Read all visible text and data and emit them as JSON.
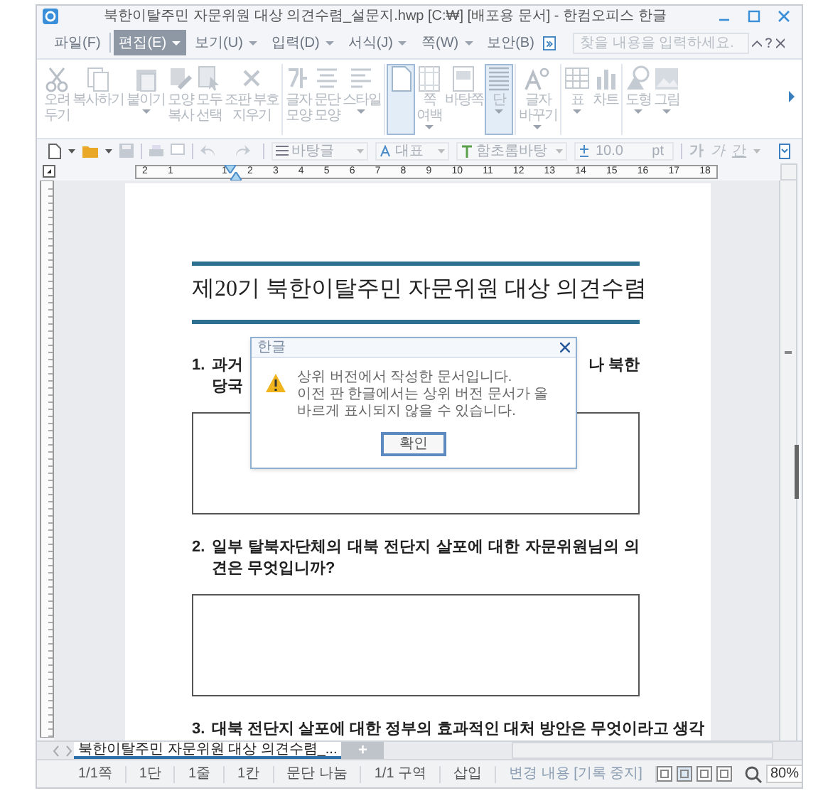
{
  "window": {
    "title": "북한이탈주민 자문위원 대상 의견수렴_설문지.hwp [C:₩] [배포용 문서] - 한컴오피스 한글"
  },
  "menu": [
    {
      "label": "파일(F)",
      "selected": false,
      "dropdown": false
    },
    {
      "label": "편집(E)",
      "selected": true,
      "dropdown": true
    },
    {
      "label": "보기(U)",
      "selected": false,
      "dropdown": true
    },
    {
      "label": "입력(D)",
      "selected": false,
      "dropdown": true
    },
    {
      "label": "서식(J)",
      "selected": false,
      "dropdown": true
    },
    {
      "label": "쪽(W)",
      "selected": false,
      "dropdown": true
    },
    {
      "label": "보안(B)",
      "selected": false,
      "dropdown": false
    }
  ],
  "search": {
    "placeholder": "찾을 내용을 입력하세요."
  },
  "ribbon": [
    [
      {
        "lines": [
          "오려",
          "두기"
        ],
        "dropdown": false,
        "selected": false
      },
      {
        "lines": [
          "복사하기"
        ],
        "dropdown": false,
        "selected": false
      },
      {
        "lines": [
          "붙이기"
        ],
        "dropdown": true,
        "selected": false
      },
      {
        "lines": [
          "모양",
          "복사"
        ],
        "dropdown": false,
        "selected": false
      },
      {
        "lines": [
          "모두",
          "선택"
        ],
        "dropdown": false,
        "selected": false
      },
      {
        "lines": [
          "조판 부호",
          "지우기"
        ],
        "dropdown": false,
        "selected": false
      }
    ],
    [
      {
        "lines": [
          "글자",
          "모양"
        ],
        "dropdown": false,
        "selected": false
      },
      {
        "lines": [
          "문단",
          "모양"
        ],
        "dropdown": false,
        "selected": false
      },
      {
        "lines": [
          "스타일"
        ],
        "dropdown": true,
        "selected": false
      }
    ],
    [
      {
        "dropdown": false,
        "selected": true
      },
      {
        "lines": [
          "쪽",
          "여백"
        ],
        "dropdown": true,
        "selected": false
      },
      {
        "lines": [
          "바탕쪽"
        ],
        "dropdown": false,
        "selected": false
      },
      {
        "lines": [
          "단"
        ],
        "dropdown": true,
        "selected": true
      }
    ],
    [
      {
        "lines": [
          "글자",
          "바꾸기"
        ],
        "dropdown": true,
        "selected": false
      }
    ],
    [
      {
        "lines": [
          "표"
        ],
        "dropdown": true,
        "selected": false
      },
      {
        "lines": [
          "차트"
        ],
        "dropdown": false,
        "selected": false
      }
    ],
    [
      {
        "lines": [
          "도형"
        ],
        "dropdown": true,
        "selected": false
      },
      {
        "lines": [
          "그림"
        ],
        "dropdown": true,
        "selected": false
      }
    ]
  ],
  "toolbar": {
    "style": "바탕글",
    "language": "대표",
    "font": "함초롬바탕",
    "size": "10.0",
    "unit": "pt",
    "format": [
      "가",
      "가",
      "간"
    ]
  },
  "ruler": {
    "labels": [
      "2",
      "1",
      "1",
      "2",
      "3",
      "4",
      "5",
      "6",
      "7",
      "8",
      "9",
      "10",
      "11",
      "12",
      "13",
      "14",
      "15",
      "16",
      "17",
      "18"
    ]
  },
  "document": {
    "title": "제20기 북한이탈주민 자문위원 대상 의견수렴",
    "questions": [
      {
        "number": "1.",
        "kind": "partial",
        "parts": [
          "과거",
          "나 북한",
          "당국"
        ],
        "answer_box": true
      },
      {
        "number": "2.",
        "kind": "full",
        "text": "일부 탈북자단체의 대북 전단지 살포에 대한 자문위원님의 의견은 무엇입니까?",
        "answer_box": true
      },
      {
        "number": "3.",
        "kind": "full",
        "text": "대북 전단지 살포에 대한 정부의 효과적인 대처 방안은 무엇이라고 생각",
        "answer_box": false
      }
    ]
  },
  "dialog": {
    "title": "한글",
    "lines": [
      "상위 버전에서 작성한 문서입니다.",
      "이전 판 한글에서는 상위 버전 문서가 올바르게 표시되지 않을 수 있습니다."
    ],
    "button": "확인"
  },
  "tabs": [
    {
      "label": "북한이탈주민 자문위원 대상 의견수렴_...",
      "selected": true
    }
  ],
  "new_tab": "+",
  "status_bar": [
    {
      "label": "1/1쪽",
      "disabled": false
    },
    {
      "label": "1단",
      "disabled": false
    },
    {
      "label": "1줄",
      "disabled": false
    },
    {
      "label": "1칸",
      "disabled": false
    },
    {
      "label": "문단 나눔",
      "disabled": false
    },
    {
      "label": "1/1 구역",
      "disabled": false
    },
    {
      "label": "삽입",
      "disabled": false
    },
    {
      "label": "변경 내용 [기록 중지]",
      "disabled": true
    }
  ],
  "zoom": "80%"
}
